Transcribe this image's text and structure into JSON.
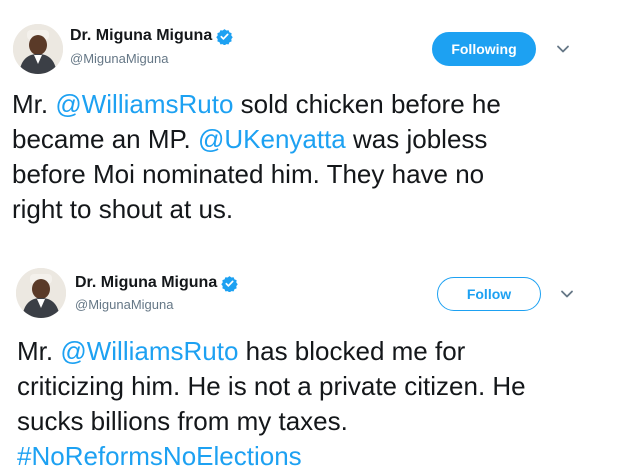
{
  "colors": {
    "accent": "#1da1f2",
    "text": "#14171a",
    "muted": "#657786"
  },
  "tweets": [
    {
      "author": {
        "display_name": "Dr. Miguna Miguna",
        "handle": "@MigunaMiguna",
        "verified_icon": "verified-badge-icon",
        "avatar": "profile-photo"
      },
      "follow_button": {
        "label": "Following",
        "state": "following"
      },
      "menu_icon": "chevron-down-icon",
      "lines": [
        [
          {
            "text": "Mr. "
          },
          {
            "text": "@WilliamsRuto",
            "link": true
          },
          {
            "text": " sold chicken before he"
          }
        ],
        [
          {
            "text": "became an MP. "
          },
          {
            "text": "@UKenyatta",
            "link": true
          },
          {
            "text": " was jobless"
          }
        ],
        [
          {
            "text": "before Moi nominated him. They have no"
          }
        ],
        [
          {
            "text": "right to shout at us."
          }
        ]
      ]
    },
    {
      "author": {
        "display_name": "Dr. Miguna Miguna",
        "handle": "@MigunaMiguna",
        "verified_icon": "verified-badge-icon",
        "avatar": "profile-photo"
      },
      "follow_button": {
        "label": "Follow",
        "state": "not-following"
      },
      "menu_icon": "chevron-down-icon",
      "lines": [
        [
          {
            "text": "Mr. "
          },
          {
            "text": "@WilliamsRuto",
            "link": true
          },
          {
            "text": " has blocked me for"
          }
        ],
        [
          {
            "text": "criticizing him. He is not a private citizen. He"
          }
        ],
        [
          {
            "text": "sucks billions from my taxes."
          }
        ],
        [
          {
            "text": "#NoReformsNoElections",
            "link": true
          }
        ]
      ]
    }
  ]
}
